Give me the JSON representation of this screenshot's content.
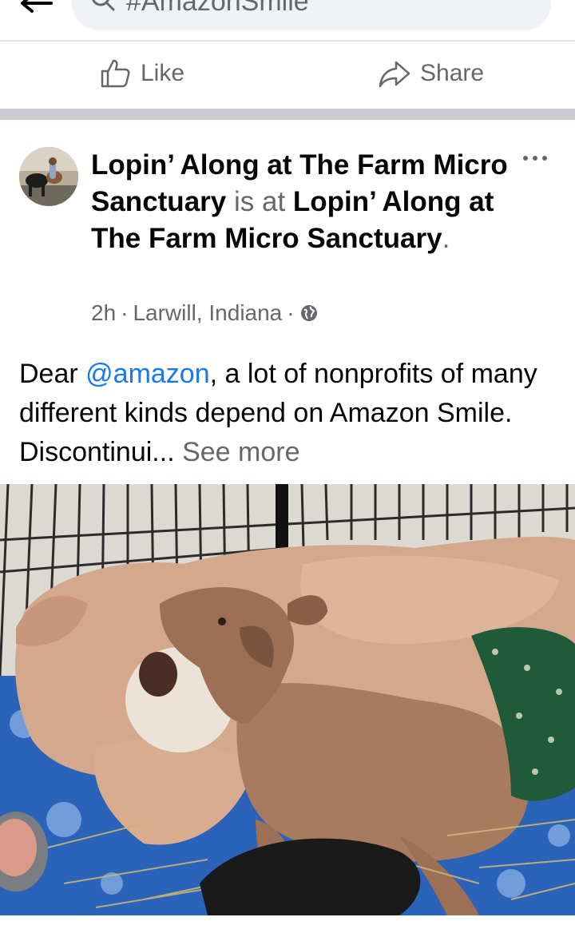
{
  "search": {
    "query": "#AmazonSmile"
  },
  "actions": {
    "like_label": "Like",
    "share_label": "Share"
  },
  "post": {
    "author": "Lopin’ Along at The Farm Micro Sanctuary",
    "connector": "is at",
    "location_page": "Lopin’ Along at The Farm Micro Sanctuary",
    "time": "2h",
    "place": "Larwill, Indiana",
    "body_prefix": "Dear ",
    "mention": "@amazon",
    "body_suffix": ", a lot of nonprofits of many different kinds depend on Amazon Smile. Discontinui...",
    "see_more": "See more",
    "privacy_icon": "globe-icon"
  },
  "colors": {
    "link": "#1877f2",
    "muted": "#65676b",
    "separator": "#c9ccd1"
  }
}
